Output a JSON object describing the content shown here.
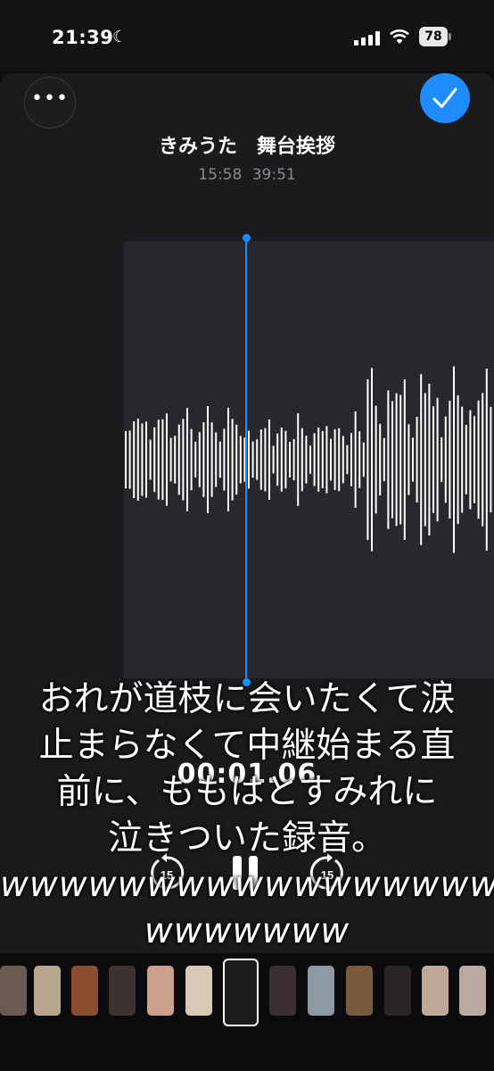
{
  "status_bar": {
    "time": "21:39",
    "battery": "78"
  },
  "recording": {
    "title": "きみうた　舞台挨拶",
    "current": "15:58",
    "total": "39:51",
    "elapsed": "00:01.06"
  },
  "controls": {
    "skip_back": "15",
    "skip_forward": "15"
  },
  "caption": {
    "lines": [
      "おれが道枝に会いたくて涙",
      "止まらなくて中継始まる直",
      "前に、ももはとすみれに",
      "泣きついた録音。",
      "wwwwwwwwwwwwwwwww",
      "wwwwwww"
    ]
  },
  "filmstrip": {
    "thumb_colors": [
      "#6a5a52",
      "#b8a58f",
      "#8a4e2f",
      "#3d3230",
      "#c9a08a",
      "#d8c8b8",
      "#1c1c1e",
      "#3a2f30",
      "#8d9aa5",
      "#7a5a3f",
      "#2a2626",
      "#c0a898",
      "#b8a8a0"
    ]
  },
  "colors": {
    "accent": "#1e8bff",
    "wave": "#ffffff"
  }
}
